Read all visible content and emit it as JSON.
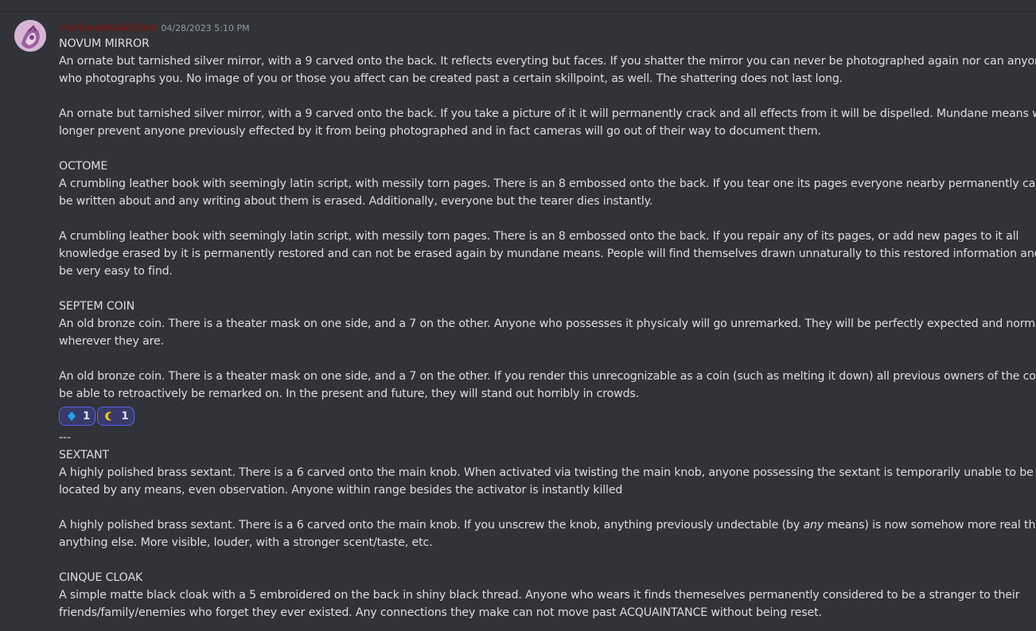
{
  "message": {
    "username": "varbaastakhlan",
    "timestamp": "04/28/2023 5:10 PM",
    "lines_before_reactions": [
      "NOVUM MIRROR",
      "An ornate but tarnished silver mirror, with a 9 carved onto the back. It reflects everyting but faces.  If you shatter the mirror you can never be photographed again nor can anyone",
      "who photographs you. No image of you or those you affect can be created past a certain skillpoint, as well. The shattering does not last long.",
      "",
      "An ornate but tarnished silver mirror, with a 9 carved onto the back. If you take a picture of it it will permanently crack and all effects from it will be dispelled. Mundane means will no",
      "longer prevent anyone previously effected by it from being photographed and in fact cameras will go out of their way to document them.",
      "",
      "OCTOME",
      "A crumbling leather book with seemingly latin script, with messily torn pages.  There is an 8 embossed onto the back. If you tear one its pages everyone nearby permanently can not",
      "be written about and any writing about them is erased. Additionally, everyone but the tearer dies instantly.",
      "",
      "A crumbling leather book with seemingly latin script, with messily torn pages.  There is an 8 embossed onto the back.  If you repair any of its pages, or add new pages to it all",
      "knowledge erased by it is permanently restored and can not be erased again by mundane means. People will find themselves drawn unnaturally to this restored information and it will",
      "be very easy to find.",
      "",
      "SEPTEM COIN",
      "An old bronze coin. There is a theater mask on one side, and a 7 on the other. Anyone who possesses it physicaly will go unremarked. They will be perfectly expected and normal",
      "wherever they are.",
      "",
      "An old bronze coin. There is a theater mask on one side, and a 7 on the other.  If you render this unrecognizable as a coin (such as melting it down) all previous owners of the coin will",
      "be able to retroactively be remarked on. In the present and future, they will stand out horribly in crowds."
    ],
    "reactions": [
      {
        "icon": "blue-diamond-icon",
        "count": "1",
        "color": "#1da1f2"
      },
      {
        "icon": "crescent-moon-icon",
        "count": "1",
        "color": "#ffcc00"
      }
    ],
    "lines_after_reactions": [
      "---",
      "SEXTANT",
      "A highly polished brass sextant. There is a 6 carved onto the main knob.  When activated via twisting the main knob, anyone possessing the sextant is temporarily unable to be",
      "located by any means, even observation. Anyone within range besides the activator is instantly killed",
      "",
      "A highly polished brass sextant. There is a 6 carved onto the main knob. If you unscrew the knob, anything previously undectable (by any means) is now somehow more real than",
      "anything else. More visible, louder, with a stronger scent/taste, etc.",
      "",
      "CINQUE CLOAK",
      "A simple matte black cloak with a 5 embroidered on the back in shiny black thread. Anyone who wears it finds themeselves permanently considered to be a stranger to their",
      "friends/family/enemies who forget they ever existed. Any connections they make can not move past ACQUAINTANCE without being reset."
    ]
  }
}
